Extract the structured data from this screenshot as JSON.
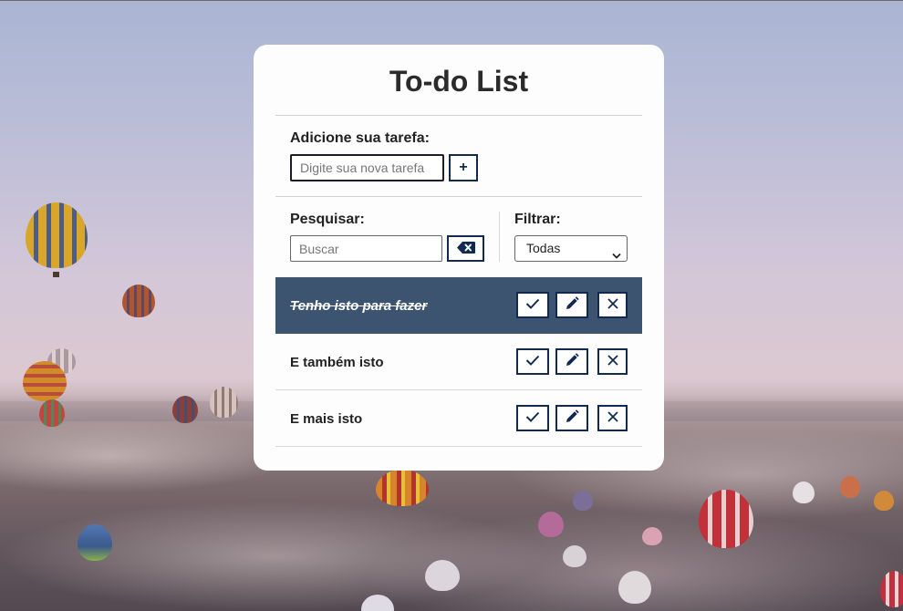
{
  "app": {
    "title": "To-do List"
  },
  "add_form": {
    "label": "Adicione sua tarefa:",
    "input_placeholder": "Digite sua nova tarefa",
    "input_value": "",
    "submit_label": "+"
  },
  "search": {
    "label": "Pesquisar:",
    "input_placeholder": "Buscar",
    "input_value": "",
    "clear_icon": "backspace-icon"
  },
  "filter": {
    "label": "Filtrar:",
    "selected": "Todas"
  },
  "todos": [
    {
      "text": "Tenho isto para fazer",
      "done": true
    },
    {
      "text": "E também isto",
      "done": false
    },
    {
      "text": "E mais isto",
      "done": false
    }
  ],
  "todo_actions": {
    "finish_icon": "check-icon",
    "edit_icon": "pencil-icon",
    "remove_icon": "close-icon"
  },
  "colors": {
    "accent": "#102a52",
    "done_row": "#3c5470",
    "card": "#fdfdfd"
  }
}
